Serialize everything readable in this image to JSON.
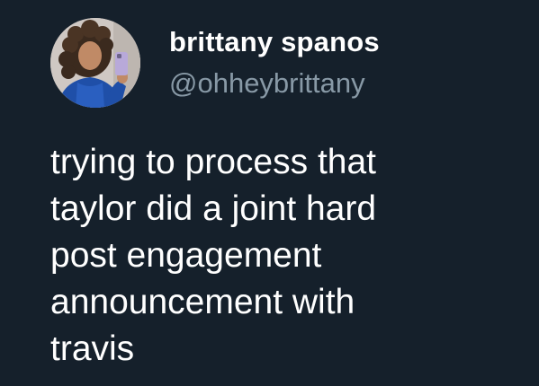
{
  "author": {
    "display_name": "brittany spanos",
    "handle": "@ohheybrittany",
    "avatar_icon": "profile-photo-avatar"
  },
  "tweet": {
    "text": "trying to process that\ntaylor did a joint hard\npost engagement\nannouncement with\ntravis"
  },
  "colors": {
    "background": "#15202b",
    "text_primary": "#ffffff",
    "text_secondary": "#8899a6"
  }
}
